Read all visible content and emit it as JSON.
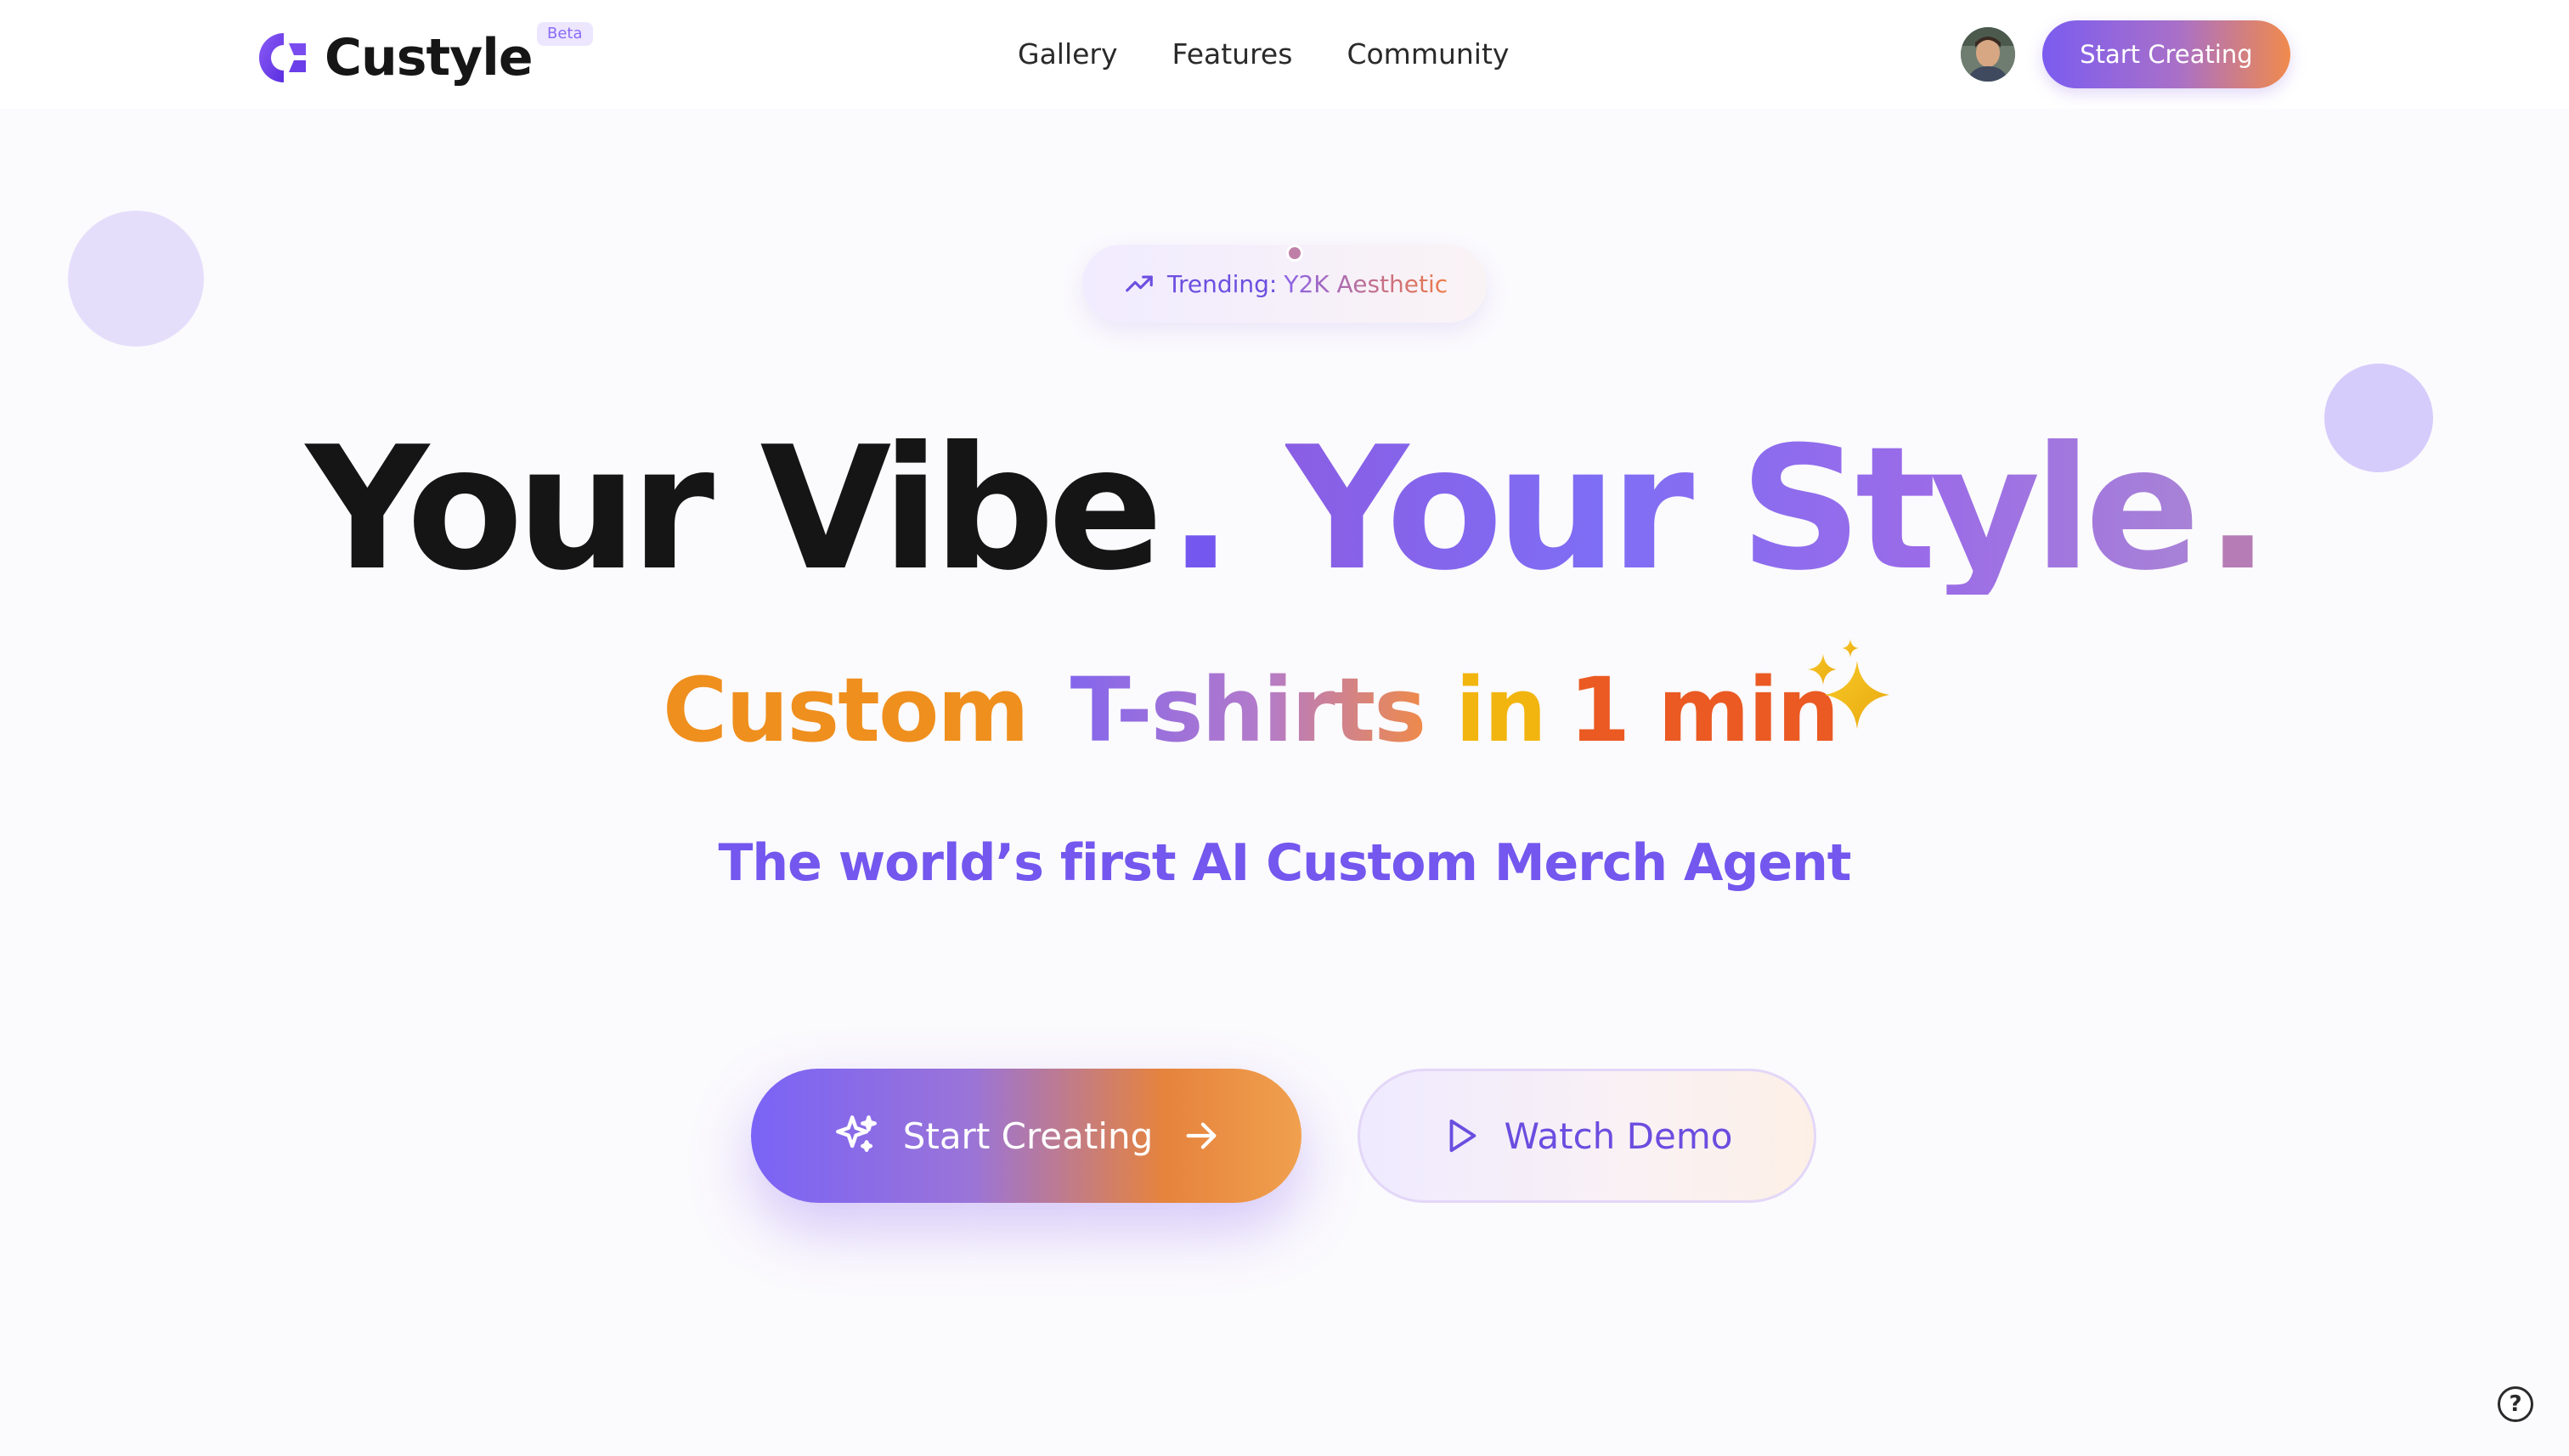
{
  "brand": {
    "name": "Custyle",
    "badge": "Beta",
    "logo_icon": "custyle-logo-icon",
    "colors": {
      "primary": "#7357ee",
      "accent": "#f08a4c",
      "text": "#151515"
    }
  },
  "nav": {
    "items": [
      {
        "label": "Gallery"
      },
      {
        "label": "Features"
      },
      {
        "label": "Community"
      }
    ]
  },
  "header": {
    "avatar_icon": "user-avatar",
    "cta_label": "Start Creating"
  },
  "trending": {
    "icon": "trending-up-icon",
    "label": "Trending:",
    "value": "Y2K Aesthetic"
  },
  "hero": {
    "headline_part1": "Your Vibe",
    "headline_dot1": ".",
    "headline_part2": "Your Style",
    "headline_dot2": ".",
    "subline": {
      "word1": "Custom",
      "word2": "T-shirts",
      "word3": "in",
      "word4": "1 min",
      "sparkle_icon": "sparkles-icon"
    },
    "tagline": "The world’s first AI Custom Merch Agent"
  },
  "cta": {
    "primary_label": "Start Creating",
    "primary_icons": [
      "sparkle-icon",
      "arrow-right-icon"
    ],
    "secondary_label": "Watch Demo",
    "secondary_icon": "play-icon"
  },
  "help": {
    "label": "?",
    "icon": "help-icon"
  }
}
